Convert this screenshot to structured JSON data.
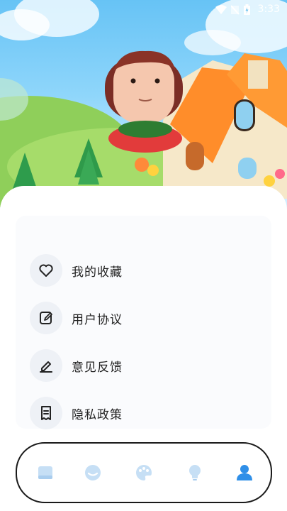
{
  "status_bar": {
    "time": "3:33",
    "icons": [
      "wifi-icon",
      "signal-icon",
      "battery-icon"
    ]
  },
  "menu": {
    "items": [
      {
        "label": "我的收藏",
        "icon": "heart-icon"
      },
      {
        "label": "用户协议",
        "icon": "edit-document-icon"
      },
      {
        "label": "意见反馈",
        "icon": "pencil-icon"
      },
      {
        "label": "隐私政策",
        "icon": "receipt-icon"
      }
    ]
  },
  "tab_bar": {
    "tabs": [
      {
        "icon": "book-icon",
        "active": false
      },
      {
        "icon": "face-icon",
        "active": false
      },
      {
        "icon": "palette-icon",
        "active": false
      },
      {
        "icon": "bulb-icon",
        "active": false
      },
      {
        "icon": "user-icon",
        "active": true
      }
    ],
    "active_color": "#2f8fe8",
    "inactive_color": "#c6dff5"
  }
}
